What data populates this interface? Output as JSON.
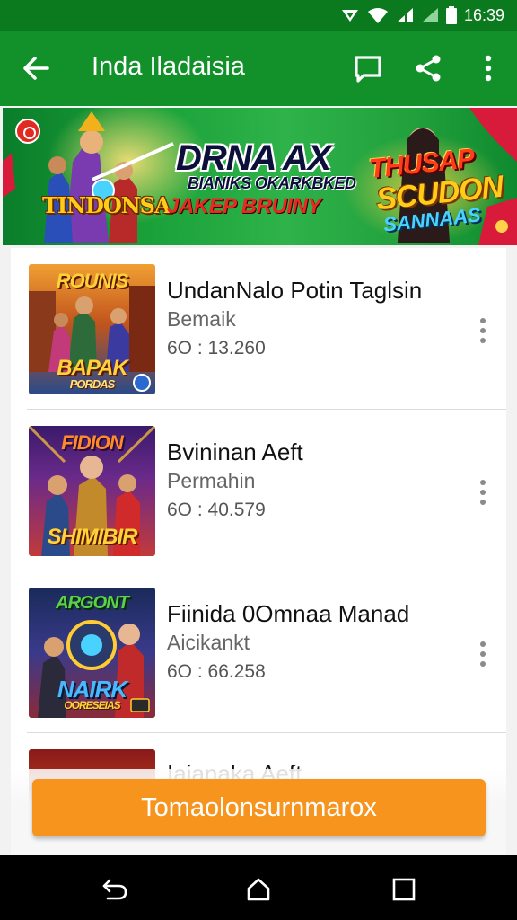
{
  "status_bar": {
    "time": "16:39",
    "icons": [
      "signal-icon",
      "wifi-icon",
      "cell-signal-icon",
      "battery-icon"
    ]
  },
  "app_bar": {
    "title": "Inda Iladaisia",
    "icons": [
      "back-arrow-icon",
      "chat-icon",
      "share-icon",
      "more-vert-icon"
    ]
  },
  "banner": {
    "logo_text": "TINDONSA",
    "headline": "DRNA AX",
    "subline": "BIANIKS OKARKBKED",
    "tagline": "JAKEP BRUINY",
    "right_line1": "THUSAP",
    "right_line2": "SCUDON",
    "right_line3": "SANNAAS"
  },
  "list": {
    "items": [
      {
        "title": "UndanNalo Potin Taglsin",
        "subtitle": "Bemaik",
        "meta": "6O : 13.260",
        "thumb_text_top": "ROUNIS",
        "thumb_text_bottom": "BAPAK",
        "thumb_text_tiny": "PORDAS"
      },
      {
        "title": "Bvininan Aeft",
        "subtitle": "Permahin",
        "meta": "6O : 40.579",
        "thumb_text_top": "FIDION",
        "thumb_text_bottom": "SHIMIBIR"
      },
      {
        "title": "Fiinida 0Omnaa Manad",
        "subtitle": "Aicikankt",
        "meta": "6O : 66.258",
        "thumb_text_top": "ARGONT",
        "thumb_text_bottom": "NAIRK",
        "thumb_text_tiny": "OORESEIAS"
      },
      {
        "title": "Iaianaka Aeft"
      }
    ]
  },
  "action": {
    "label": "Tomaolonsurnmarox"
  },
  "colors": {
    "status_bar": "#0b7a1e",
    "app_bar": "#12912b",
    "action_button": "#f7941d",
    "nav_bar": "#000000"
  }
}
